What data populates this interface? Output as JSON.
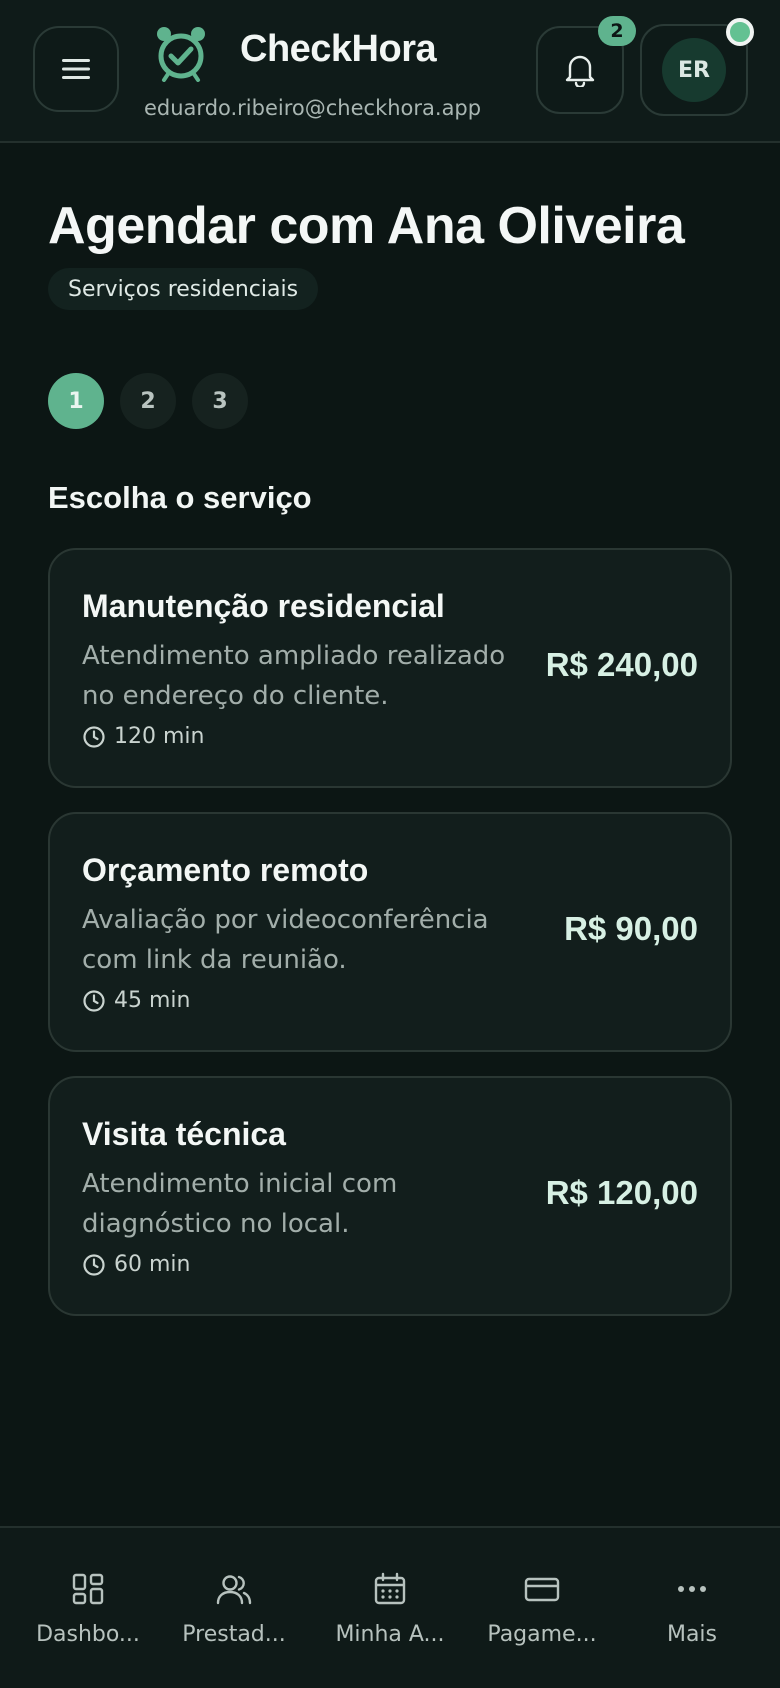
{
  "header": {
    "brand": "CheckHora",
    "email": "eduardo.ribeiro@checkhora.app",
    "notification_count": "2",
    "avatar_initials": "ER"
  },
  "booking": {
    "title": "Agendar com Ana Oliveira",
    "category": "Serviços residenciais",
    "steps": [
      "1",
      "2",
      "3"
    ],
    "active_step": 1,
    "section_title": "Escolha o serviço"
  },
  "services": [
    {
      "name": "Manutenção residencial",
      "description": "Atendimento ampliado realizado no endereço do cliente.",
      "duration": "120 min",
      "price": "R$ 240,00"
    },
    {
      "name": "Orçamento remoto",
      "description": "Avaliação por videoconferência com link da reunião.",
      "duration": "45 min",
      "price": "R$ 90,00"
    },
    {
      "name": "Visita técnica",
      "description": "Atendimento inicial com diagnóstico no local.",
      "duration": "60 min",
      "price": "R$ 120,00"
    }
  ],
  "bottom_nav": [
    {
      "label": "Dashbo...",
      "icon": "dashboard-icon"
    },
    {
      "label": "Prestad...",
      "icon": "users-icon"
    },
    {
      "label": "Minha A...",
      "icon": "calendar-icon"
    },
    {
      "label": "Pagame...",
      "icon": "credit-card-icon"
    },
    {
      "label": "Mais",
      "icon": "more-icon"
    }
  ],
  "colors": {
    "accent": "#5fb38e",
    "background": "#0c1614",
    "card": "#121e1c",
    "price": "#d7f0e4"
  }
}
